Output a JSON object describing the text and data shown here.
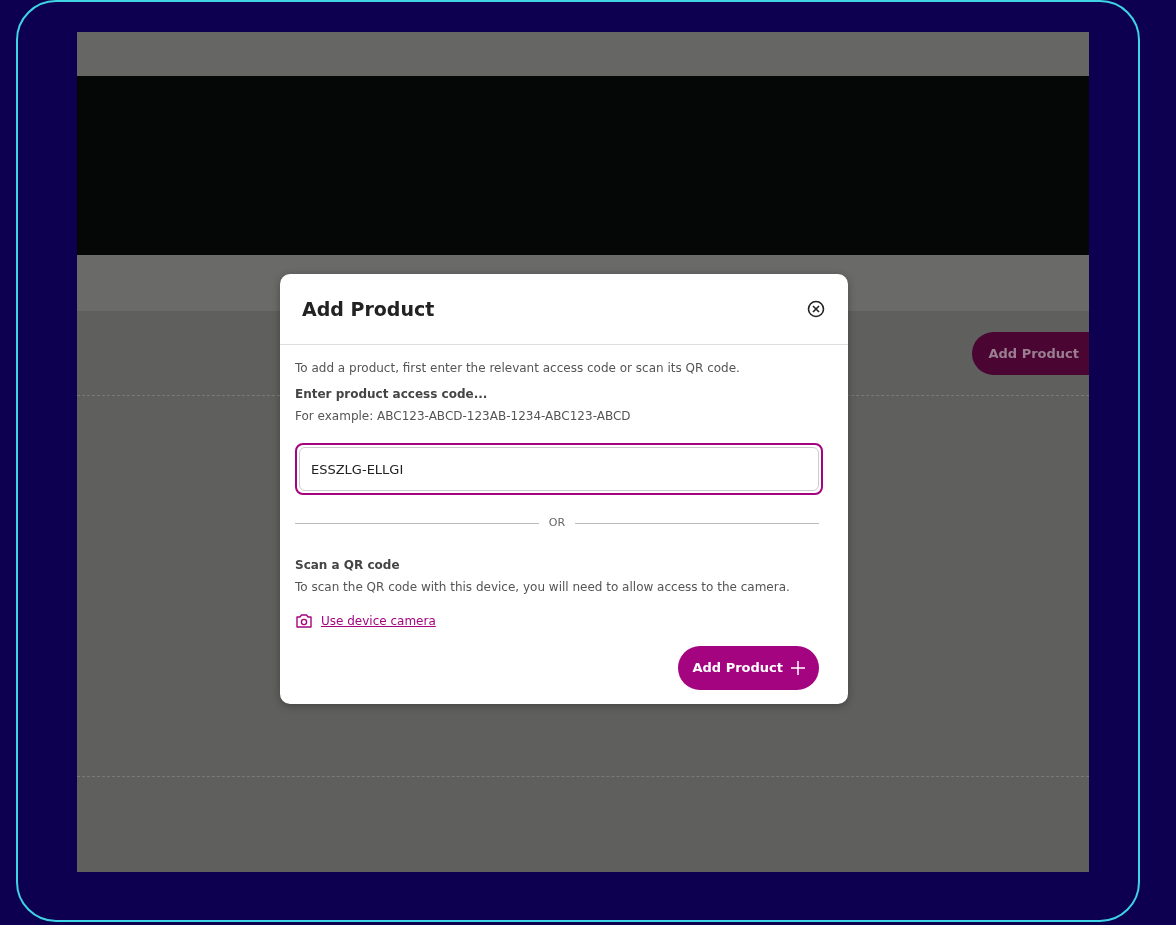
{
  "background_page": {
    "header_button": "Add Product"
  },
  "modal": {
    "title": "Add Product",
    "intro": "To add a product, first enter the relevant access code or scan its QR code.",
    "field_label": "Enter product access code...",
    "example": "For example: ABC123-ABCD-123AB-1234-ABC123-ABCD",
    "access_code": {
      "value": "ESSZLG-ELLGI",
      "focused": true
    },
    "divider_text": "OR",
    "qr_heading": "Scan a QR code",
    "qr_text": "To scan the QR code with this device, you will need to allow access to the camera.",
    "camera_link": "Use device camera",
    "submit_button": "Add Product"
  }
}
